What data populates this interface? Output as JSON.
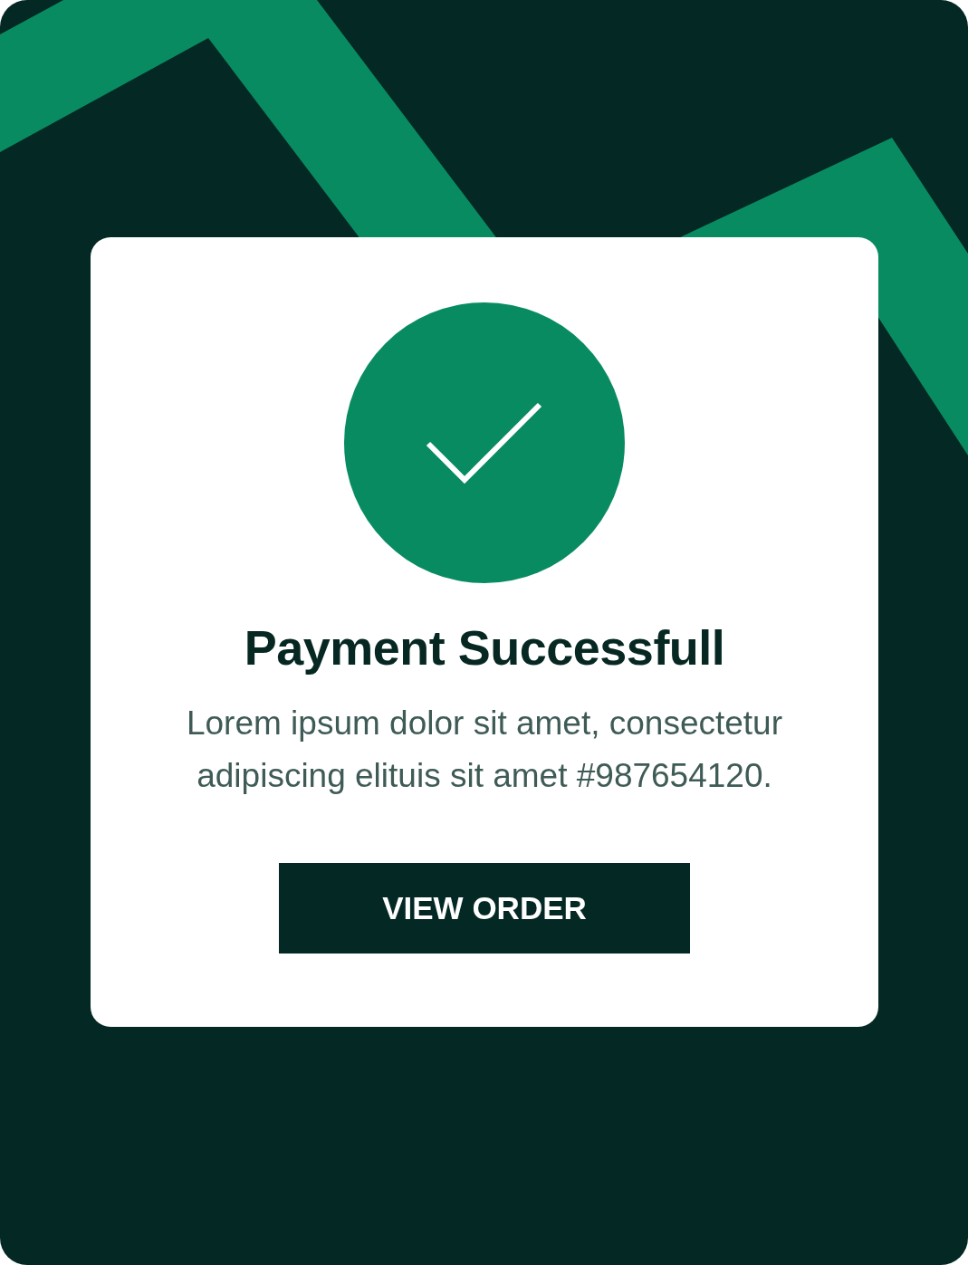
{
  "title": "Payment Successfull",
  "message": "Lorem ipsum dolor sit amet, consectetur adipiscing elituis sit amet #987654120.",
  "button": {
    "label": "VIEW ORDER"
  }
}
